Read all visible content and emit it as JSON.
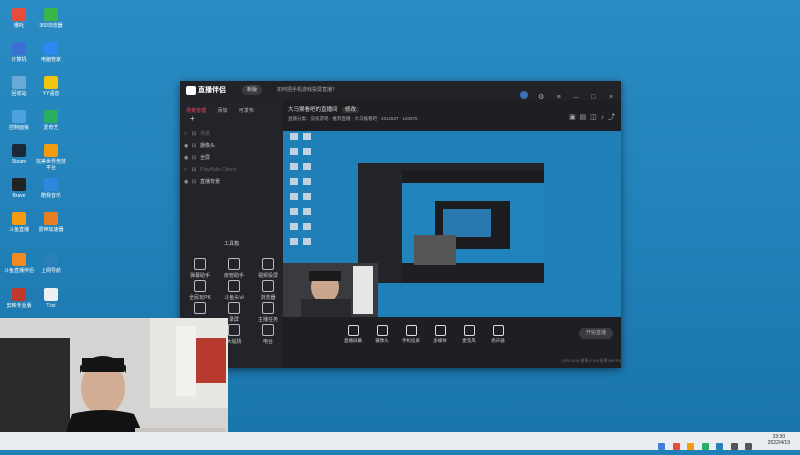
{
  "desktop": {
    "icons": [
      {
        "label": "哪吒",
        "color": "#e74c3c"
      },
      {
        "label": "360浏览器",
        "color": "#3ab54a"
      },
      {
        "label": "计算机",
        "color": "#3b6fd4"
      },
      {
        "label": "电脑管家",
        "color": "#2d89ef"
      },
      {
        "label": "回收站",
        "color": "#6aaad8"
      },
      {
        "label": "YY语音",
        "color": "#f1c40f"
      },
      {
        "label": "控制面板",
        "color": "#4aa3df"
      },
      {
        "label": "爱奇艺",
        "color": "#27ae60"
      },
      {
        "label": "Steam",
        "color": "#1b2838"
      },
      {
        "label": "完美世界竞技平台",
        "color": "#f39c12"
      },
      {
        "label": "Brave",
        "color": "#222"
      },
      {
        "label": "酷我音乐",
        "color": "#2e86de"
      },
      {
        "label": "斗鱼直播",
        "color": "#f39c12"
      },
      {
        "label": "雷神加速器",
        "color": "#e67e22"
      },
      {
        "label": "斗鱼直播伴侣",
        "color": "#f08a24"
      },
      {
        "label": "上网导航",
        "color": "#2980b9"
      },
      {
        "label": "剪映专业版",
        "color": "#c0392b"
      },
      {
        "label": "T.txt",
        "color": "#ecf0f1"
      }
    ]
  },
  "window": {
    "app_name": "直播伴侣",
    "version_pill": "新版",
    "notice": "如何把手机游戏投屏直播？",
    "sidebar": {
      "tabs": [
        "场景管理",
        "添加",
        "可发布"
      ],
      "sources": [
        {
          "label": "场景",
          "visible": false
        },
        {
          "label": "摄像头",
          "visible": true
        },
        {
          "label": "全屏",
          "visible": true
        },
        {
          "label": "PlayBalls Check",
          "visible": false
        },
        {
          "label": "直播背景",
          "visible": true
        }
      ],
      "tools_title": "工具箱",
      "tools": [
        "弹幕助手",
        "房管助手",
        "视频投屏",
        "全民玩PK",
        "斗鱼头Ⅵ",
        "浏览器",
        "",
        "录屏",
        "主播任务",
        "",
        "大幅扬",
        "电台"
      ]
    },
    "room_title": "大马猴看吧的直播间",
    "room_badge": "修改",
    "room_info": "直播分类：竞技游戏 · 推荐直播 · 大马猴看吧 · 4212637 · 120576",
    "bottom_items": [
      "直播屏幕",
      "摄像头",
      "手机投屏",
      "多媒体",
      "麦克风",
      "扬声器"
    ],
    "start_button": "开始直播",
    "status_text": "CPU:31%  帧率:0.0%  帧率:60FPS"
  },
  "taskbar": {
    "time": "23:30",
    "date": "2022/4/19"
  }
}
